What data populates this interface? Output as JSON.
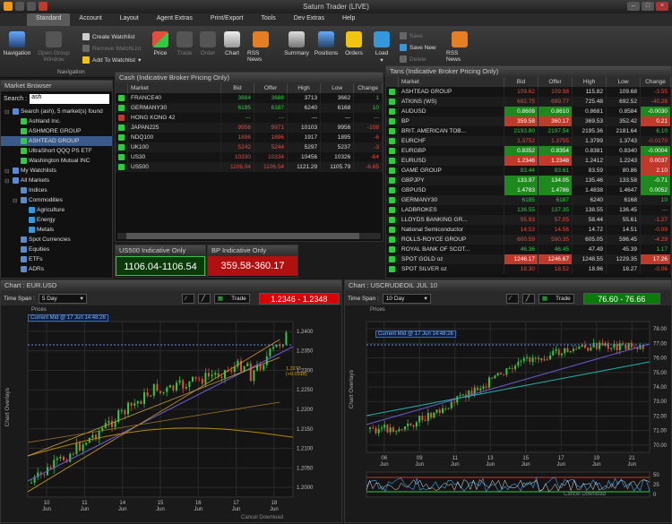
{
  "window": {
    "title": "Saturn Trader (LIVE)"
  },
  "menu": [
    "Standard",
    "Account",
    "Layout",
    "Agent Extras",
    "Print/Export",
    "Tools",
    "Dev Extras",
    "Help"
  ],
  "ribbon": {
    "navigation": "Navigation",
    "open_group_window": "Open Group Window",
    "create_watchlist": "Create Watchlist",
    "remove_watchlist": "Remove WatchList",
    "add_to_watchlist": "Add To Watchlist",
    "group_label": "Navigation",
    "price": "Price",
    "trade": "Trade",
    "order": "Order",
    "chart": "Chart",
    "rss_news": "RSS News",
    "summary": "Summary",
    "positions": "Positions",
    "orders": "Orders",
    "load": "Load",
    "save": "Save",
    "save_new": "Save New",
    "delete": "Delete",
    "rss_news2": "RSS News"
  },
  "market_browser": {
    "title": "Market Browser",
    "search_label": "Search :",
    "search_value": "ash",
    "tree": [
      {
        "label": "Search (ash), 5 market(s) found",
        "level": 0
      },
      {
        "label": "Ashland Inc.",
        "level": 1
      },
      {
        "label": "ASHMORE GROUP",
        "level": 1
      },
      {
        "label": "ASHTEAD GROUP",
        "level": 1,
        "selected": true
      },
      {
        "label": "UltraShort QQQ PS ETF",
        "level": 1
      },
      {
        "label": "Washington Mutual INC",
        "level": 1
      },
      {
        "label": "My Watchlists",
        "level": 0
      },
      {
        "label": "All Markets",
        "level": 0
      },
      {
        "label": "Indices",
        "level": 1
      },
      {
        "label": "Commodities",
        "level": 1
      },
      {
        "label": "Agriculture",
        "level": 2
      },
      {
        "label": "Energy",
        "level": 2
      },
      {
        "label": "Metals",
        "level": 2
      },
      {
        "label": "Spot Currencies",
        "level": 1
      },
      {
        "label": "Equities",
        "level": 1
      },
      {
        "label": "ETFs",
        "level": 1
      },
      {
        "label": "ADRs",
        "level": 1
      }
    ]
  },
  "cash": {
    "title": "Cash (Indicative Broker Pricing Only)",
    "columns": [
      "Market",
      "Bid",
      "Offer",
      "High",
      "Low",
      "Change"
    ],
    "rows": [
      [
        "FRANCE40",
        "3684",
        "3688",
        "3713",
        "3662",
        "1"
      ],
      [
        "GERMANY30",
        "6185",
        "6187",
        "6240",
        "6168",
        "10"
      ],
      [
        "HONG KONG 42",
        "---",
        "---",
        "---",
        "---",
        "---"
      ],
      [
        "JAPAN225",
        "9956",
        "9971",
        "10103",
        "9956",
        "-108"
      ],
      [
        "NDQ100",
        "1896",
        "1896",
        "1917",
        "1895",
        "-6"
      ],
      [
        "UK100",
        "5242",
        "5244",
        "5297",
        "5237",
        "-3"
      ],
      [
        "US30",
        "10330",
        "10334",
        "10456",
        "10326",
        "-64"
      ],
      [
        "US500",
        "1106.04",
        "1106.54",
        "1121.29",
        "1105.79",
        "-6.65"
      ]
    ]
  },
  "indicative": [
    {
      "label": "US500 Indicative Only",
      "price": "1106.04-1106.54",
      "color": "green"
    },
    {
      "label": "BP Indicative Only",
      "price": "359.58-360.17",
      "color": "red"
    }
  ],
  "tans": {
    "title": "Tans (Indicative Broker Pricing Only)",
    "columns": [
      "Market",
      "Bid",
      "Offer",
      "High",
      "Low",
      "Change"
    ],
    "rows": [
      [
        "ASHTEAD GROUP",
        "109.62",
        "109.98",
        "115.82",
        "109.68",
        "-3.55"
      ],
      [
        "ATKINS (WS)",
        "692.75",
        "699.77",
        "725.48",
        "692.52",
        "-40.28"
      ],
      [
        "AUDUSD",
        "0.8608",
        "0.8610",
        "0.8681",
        "0.8584",
        "-0.0030"
      ],
      [
        "BP",
        "359.58",
        "360.17",
        "369.53",
        "352.42",
        "0.21"
      ],
      [
        "BRIT. AMERICAN TOB...",
        "2193.80",
        "2197.54",
        "2195.36",
        "2181.64",
        "6.10"
      ],
      [
        "EURCHF",
        "1.3752",
        "1.3755",
        "1.3799",
        "1.3743",
        "-0.0170"
      ],
      [
        "EURGBP",
        "0.8352",
        "0.8354",
        "0.8381",
        "0.8340",
        "-0.0004"
      ],
      [
        "EURUSD",
        "1.2346",
        "1.2348",
        "1.2412",
        "1.2243",
        "0.0037"
      ],
      [
        "GAME GROUP",
        "83.44",
        "83.61",
        "83.59",
        "80.86",
        "2.10"
      ],
      [
        "GBPJPY",
        "133.97",
        "134.05",
        "135.46",
        "133.58",
        "-0.71"
      ],
      [
        "GBPUSD",
        "1.4783",
        "1.4786",
        "1.4838",
        "1.4647",
        "0.0052"
      ],
      [
        "GERMANY30",
        "6185",
        "6187",
        "6240",
        "6168",
        "10"
      ],
      [
        "LADBROKES",
        "136.55",
        "137.35",
        "138.55",
        "136.45",
        "---"
      ],
      [
        "LLOYDS BANKING GR...",
        "55.93",
        "57.05",
        "58.44",
        "55.61",
        "-1.27"
      ],
      [
        "National Semiconductor",
        "14.53",
        "14.56",
        "14.72",
        "14.51",
        "-0.09"
      ],
      [
        "ROLLS-ROYCE GROUP",
        "600.59",
        "590.35",
        "605.05",
        "596.45",
        "-4.29"
      ],
      [
        "ROYAL BANK OF SCOT...",
        "46.36",
        "46.45",
        "47.49",
        "45.39",
        "1.17"
      ],
      [
        "SPOT GOLD oz",
        "1246.17",
        "1246.67",
        "1248.55",
        "1229.35",
        "17.26"
      ],
      [
        "SPOT SILVER oz",
        "18.30",
        "18.52",
        "18.96",
        "18.27",
        "-0.06"
      ]
    ]
  },
  "chart_eur": {
    "title": "Chart : EUR.USD",
    "time_span_label": "Time Span :",
    "time_span": "5 Day",
    "trade": "Trade",
    "price": "1.2346 - 1.2348",
    "prices_label": "Prices",
    "overlays": "Chart Overlays",
    "mid_label": "Current Mid @ 17 Jun 14:48:26",
    "annot1": "1.2273",
    "annot2": "(+0.0318)",
    "yticks": [
      "1.2400",
      "1.2350",
      "1.2300",
      "1.2250",
      "1.2200",
      "1.2150",
      "1.2100",
      "1.2050",
      "1.2000"
    ],
    "xticks": [
      [
        "10",
        "Jun"
      ],
      [
        "11",
        "Jun"
      ],
      [
        "14",
        "Jun"
      ],
      [
        "15",
        "Jun"
      ],
      [
        "16",
        "Jun"
      ],
      [
        "17",
        "Jun"
      ],
      [
        "18",
        "Jun"
      ]
    ],
    "cancel": "Cancel Download"
  },
  "chart_oil": {
    "title": "Chart : USCRUDEOIL JUL 10",
    "time_span_label": "Time Span :",
    "time_span": "10 Day",
    "trade": "Trade",
    "price": "76.60 - 76.66",
    "prices_label": "Prices",
    "overlays": "Chart Overlays",
    "mid_label": "Current Mid @ 17 Jun 14:48:26",
    "yticks": [
      "78.00",
      "77.00",
      "76.00",
      "75.00",
      "74.00",
      "73.00",
      "72.00",
      "71.00",
      "70.00"
    ],
    "osc_ticks": [
      "50",
      "25",
      "0"
    ],
    "xticks": [
      [
        "06",
        "Jun"
      ],
      [
        "09",
        "Jun"
      ],
      [
        "11",
        "Jun"
      ],
      [
        "13",
        "Jun"
      ],
      [
        "15",
        "Jun"
      ],
      [
        "17",
        "Jun"
      ],
      [
        "19",
        "Jun"
      ],
      [
        "21",
        "Jun"
      ]
    ],
    "cancel": "Cancel Download"
  },
  "colors": {
    "up": "#2ecc40",
    "down": "#e74c3c",
    "accent": "#d4a017"
  }
}
